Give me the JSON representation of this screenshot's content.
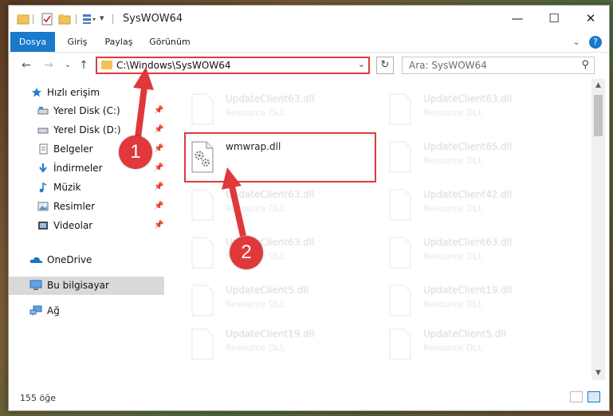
{
  "window": {
    "title": "SysWOW64",
    "controls": {
      "minimize": "—",
      "maximize": "☐",
      "close": "✕"
    }
  },
  "ribbon": {
    "tabs": [
      "Dosya",
      "Giriş",
      "Paylaş",
      "Görünüm"
    ],
    "expand": "⌄",
    "help": "?"
  },
  "nav": {
    "address": "C:\\Windows\\SysWOW64",
    "search_placeholder": "Ara: SysWOW64"
  },
  "sidebar": {
    "items": [
      {
        "label": "Hızlı erişim",
        "icon": "star-icon"
      },
      {
        "label": "Yerel Disk (C:)",
        "icon": "disk-icon",
        "pinned": true
      },
      {
        "label": "Yerel Disk (D:)",
        "icon": "disk-icon",
        "pinned": true
      },
      {
        "label": "Belgeler",
        "icon": "documents-icon",
        "pinned": true
      },
      {
        "label": "İndirmeler",
        "icon": "download-icon",
        "pinned": true
      },
      {
        "label": "Müzik",
        "icon": "music-icon",
        "pinned": true
      },
      {
        "label": "Resimler",
        "icon": "pictures-icon",
        "pinned": true
      },
      {
        "label": "Videolar",
        "icon": "videos-icon",
        "pinned": true
      },
      {
        "label": "OneDrive",
        "icon": "onedrive-icon"
      },
      {
        "label": "Bu bilgisayar",
        "icon": "computer-icon",
        "selected": true
      },
      {
        "label": "Ağ",
        "icon": "network-icon"
      }
    ]
  },
  "files": {
    "left_column": [
      {
        "name": "UpdateClient63.dll",
        "type": "Resource DLL"
      },
      {
        "name": "wmwrap.dll",
        "type": ""
      },
      {
        "name": "UpdateClient63.dll",
        "type": "Resource DLL"
      },
      {
        "name": "UpdateClient63.dll",
        "type": "Resource DLL"
      },
      {
        "name": "UpdateClient5.dll",
        "type": "Resource DLL"
      },
      {
        "name": "UpdateClient19.dll",
        "type": "Resource DLL"
      }
    ],
    "right_column": [
      {
        "name": "UpdateClient63.dll",
        "type": "Resource DLL"
      },
      {
        "name": "UpdateClient65.dll",
        "type": "Resource DLL"
      },
      {
        "name": "UpdateClient42.dll",
        "type": "Resource DLL"
      },
      {
        "name": "UpdateClient63.dll",
        "type": "Resource DLL"
      },
      {
        "name": "UpdateClient19.dll",
        "type": "Resource DLL"
      },
      {
        "name": "UpdateClient5.dll",
        "type": "Resource DLL"
      }
    ]
  },
  "status": {
    "item_count": "155 öğe"
  },
  "annotations": {
    "step1": "1",
    "step2": "2",
    "color": "#e0383b"
  }
}
